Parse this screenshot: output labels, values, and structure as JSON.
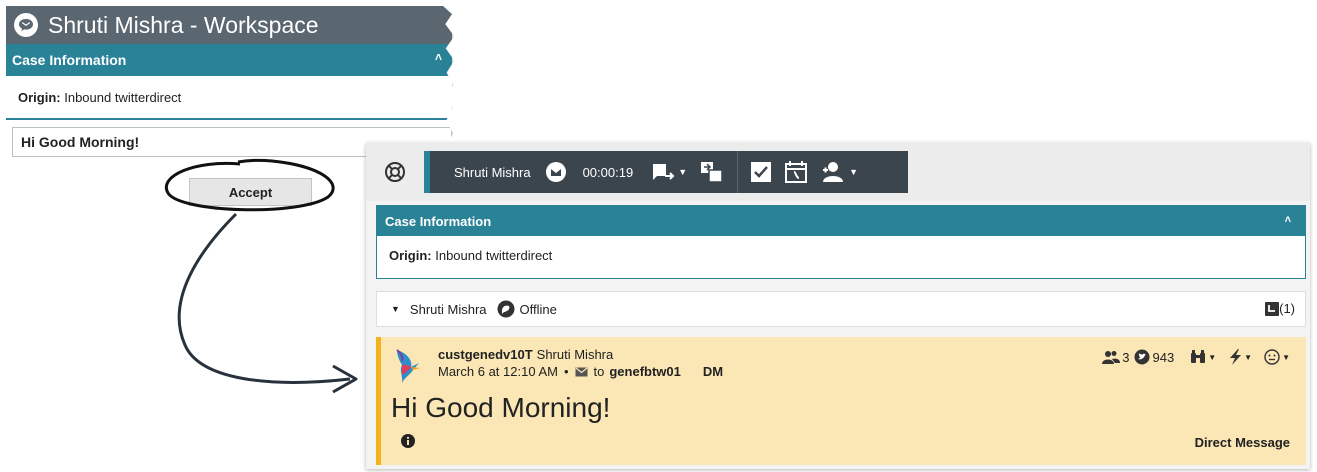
{
  "popup": {
    "title": "Shruti Mishra - Workspace",
    "case_header": "Case Information",
    "origin_label": "Origin:",
    "origin_value": "Inbound twitterdirect",
    "message": "Hi Good Morning!",
    "accept_label": "Accept"
  },
  "workspace": {
    "toolbar": {
      "contact_name": "Shruti Mishra",
      "timer": "00:00:19"
    },
    "case_panel": {
      "header": "Case Information",
      "origin_label": "Origin:",
      "origin_value": "Inbound twitterdirect"
    },
    "contact_row": {
      "name": "Shruti Mishra",
      "status": "Offline",
      "count": "(1)"
    },
    "tweet": {
      "handle": "custgenedv10T",
      "display_name": "Shruti Mishra",
      "date": "March 6 at 12:10 AM",
      "dot": "•",
      "to_label": "to",
      "recipient": "genefbtw01",
      "dm_tag": "DM",
      "text": "Hi Good Morning!",
      "followers": "3",
      "following": "943",
      "type_label": "Direct Message"
    }
  },
  "colors": {
    "teal": "#2a8296",
    "dark_toolbar": "#3b454d",
    "title_gray": "#5b6770",
    "tweet_bg": "#fbe6b6",
    "tweet_accent": "#f2b31b"
  }
}
